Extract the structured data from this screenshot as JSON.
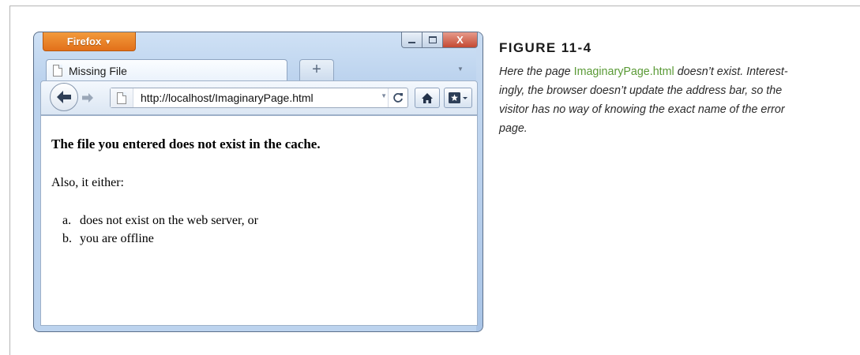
{
  "browser": {
    "app_button": "Firefox",
    "close_glyph": "X",
    "tab_title": "Missing File",
    "new_tab_glyph": "+",
    "url": "http://localhost/ImaginaryPage.html"
  },
  "page": {
    "heading": "The file you entered does not exist in the cache.",
    "paragraph": "Also, it either:",
    "list": [
      {
        "marker": "a.",
        "text": "does not exist on the web server, or"
      },
      {
        "marker": "b.",
        "text": "you are offline"
      }
    ]
  },
  "caption": {
    "figure_label": "FIGURE 11-4",
    "lines": [
      {
        "before": "Here the page ",
        "link": "ImaginaryPage.html",
        "after": " doesn’t exist. Interest-"
      },
      {
        "before": "ingly, the browser doesn’t update the address bar, so the",
        "link": "",
        "after": ""
      },
      {
        "before": "visitor has no way of knowing the exact name of the error",
        "link": "",
        "after": ""
      },
      {
        "before": "page.",
        "link": "",
        "after": ""
      }
    ]
  },
  "colors": {
    "link_green": "#5a9a36",
    "firefox_orange": "#e2701a",
    "window_frame_blue": "#bcd3ee"
  },
  "icons": [
    "page-icon",
    "back-arrow-icon",
    "forward-arrow-icon",
    "reload-icon",
    "home-icon",
    "bookmarks-icon",
    "minimize-icon",
    "maximize-icon",
    "close-icon"
  ]
}
